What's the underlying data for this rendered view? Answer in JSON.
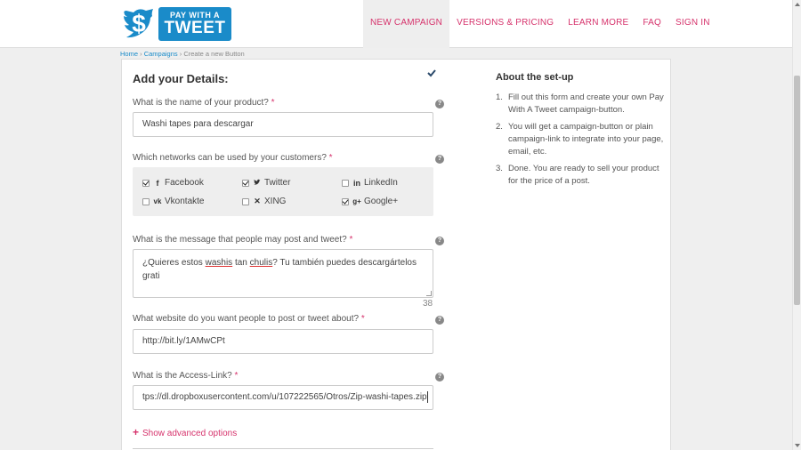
{
  "brand": {
    "logo_line1": "PAY WITH A",
    "logo_line2": "TWEET",
    "logo_icon": "dollar-bird-icon",
    "brand_color": "#1a8bc9",
    "accent_color": "#d6336c"
  },
  "nav": {
    "items": [
      {
        "label": "NEW CAMPAIGN",
        "active": true
      },
      {
        "label": "VERSIONS & PRICING",
        "active": false
      },
      {
        "label": "LEARN MORE",
        "active": false
      },
      {
        "label": "FAQ",
        "active": false
      },
      {
        "label": "SIGN IN",
        "active": false
      }
    ]
  },
  "breadcrumb": {
    "home": "Home",
    "sep1": "›",
    "campaigns": "Campaigns",
    "sep2": "›",
    "current": "Create a new Button"
  },
  "form": {
    "title": "Add your Details:",
    "product": {
      "label": "What is the name of your product?",
      "required": "*",
      "value": "Washi tapes para descargar"
    },
    "networks": {
      "label": "Which networks can be used by your customers?",
      "required": "*",
      "items": [
        {
          "label": "Facebook",
          "icon": "f",
          "checked": true
        },
        {
          "label": "Twitter",
          "icon": "twitter-bird",
          "checked": true
        },
        {
          "label": "LinkedIn",
          "icon": "in",
          "checked": false
        },
        {
          "label": "Vkontakte",
          "icon": "vk",
          "checked": false
        },
        {
          "label": "XING",
          "icon": "xing",
          "checked": false
        },
        {
          "label": "Google+",
          "icon": "g+",
          "checked": true
        }
      ]
    },
    "message": {
      "label": "What is the message that people may post and tweet?",
      "required": "*",
      "value_part1": "¿Quieres estos ",
      "value_u1": "washis",
      "value_part2": " tan ",
      "value_u2": "chulis",
      "value_part3": "? Tu también puedes descargártelos",
      "value_line2": "grati",
      "counter": "38"
    },
    "website": {
      "label": "What website do you want people to post or tweet about?",
      "required": "*",
      "value": "http://bit.ly/1AMwCPt"
    },
    "access": {
      "label": "What is the Access-Link?",
      "required": "*",
      "value": "tps://dl.dropboxusercontent.com/u/107222565/Otros/Zip-washi-tapes.zip"
    },
    "advanced": "Show advanced options",
    "help_glyph": "?"
  },
  "aside": {
    "title": "About the set-up",
    "steps": [
      {
        "n": "1.",
        "text": "Fill out this form and create your own Pay With A Tweet campaign-button."
      },
      {
        "n": "2.",
        "text": "You will get a campaign-button or plain campaign-link to integrate into your page, email, etc."
      },
      {
        "n": "3.",
        "text": "Done. You are ready to sell your product for the price of a post."
      }
    ]
  }
}
